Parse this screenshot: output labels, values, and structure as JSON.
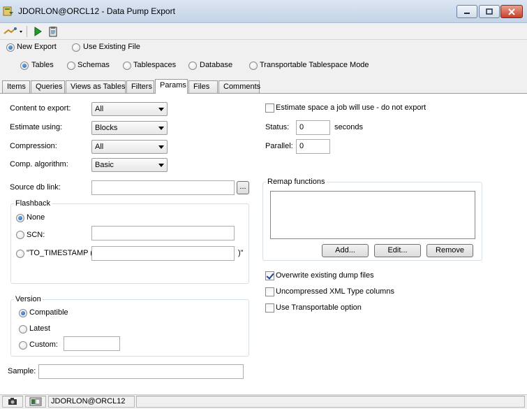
{
  "window": {
    "title": "JDORLON@ORCL12 - Data Pump Export"
  },
  "mode": {
    "new_export": "New Export",
    "use_existing": "Use Existing File",
    "selected": "New Export"
  },
  "scope": {
    "options": [
      "Tables",
      "Schemas",
      "Tablespaces",
      "Database",
      "Transportable Tablespace Mode"
    ],
    "selected": "Tables"
  },
  "tabs": [
    "Items",
    "Queries",
    "Views as Tables",
    "Filters",
    "Params",
    "Files",
    "Comments"
  ],
  "active_tab": "Params",
  "params": {
    "content_label": "Content to export:",
    "content_value": "All",
    "estimate_label": "Estimate using:",
    "estimate_value": "Blocks",
    "compression_label": "Compression:",
    "compression_value": "All",
    "algorithm_label": "Comp. algorithm:",
    "algorithm_value": "Basic",
    "source_db_link_label": "Source db link:",
    "source_db_link_value": "",
    "browse_button": "...",
    "sample_label": "Sample:",
    "sample_value": ""
  },
  "flashback": {
    "title": "Flashback",
    "none": "None",
    "scn": "SCN:",
    "to_timestamp": "\"TO_TIMESTAMP (",
    "to_timestamp_close": ")\"",
    "selected": "None",
    "scn_value": "",
    "timestamp_value": ""
  },
  "version": {
    "title": "Version",
    "compatible": "Compatible",
    "latest": "Latest",
    "custom": "Custom:",
    "custom_value": "",
    "selected": "Compatible"
  },
  "right": {
    "estimate_only_label": "Estimate space a job will use - do not export",
    "estimate_only_checked": false,
    "status_label": "Status:",
    "status_value": "0",
    "status_unit": "seconds",
    "parallel_label": "Parallel:",
    "parallel_value": "0",
    "remap_title": "Remap functions",
    "add_button": "Add...",
    "edit_button": "Edit...",
    "remove_button": "Remove",
    "overwrite_label": "Overwrite existing dump files",
    "overwrite_checked": true,
    "uncompressed_xml_label": "Uncompressed XML Type columns",
    "uncompressed_xml_checked": false,
    "transportable_label": "Use Transportable option",
    "transportable_checked": false
  },
  "statusbar": {
    "connection": "JDORLON@ORCL12"
  },
  "icons": {
    "app": "data-pump-icon",
    "connect": "connect-dropdown-icon",
    "run": "run-icon",
    "clipboard": "clipboard-icon",
    "camera": "camera-icon",
    "db": "database-icon"
  },
  "colors": {
    "title_bar": "#c4d3e6",
    "run_green": "#1e9e2a",
    "close_red": "#c8412b"
  }
}
